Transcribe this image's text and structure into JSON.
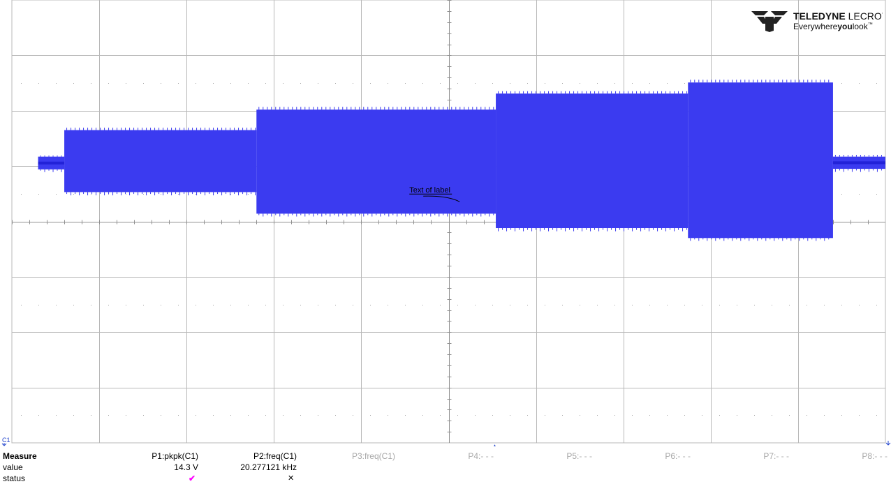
{
  "chart_data": {
    "type": "line",
    "title": "",
    "xlabel": "",
    "ylabel": "",
    "grid": true,
    "grid_divisions": {
      "x": 10,
      "y": 8
    },
    "xlim": [
      0,
      10
    ],
    "ylim": [
      -4,
      4
    ],
    "x_unit": "div",
    "y_unit": "div",
    "trace_color": "#3b3bf0",
    "series": [
      {
        "segments": [
          {
            "x_start": 0.3,
            "x_end": 0.6,
            "y_min": 0.94,
            "y_max": 1.17
          },
          {
            "x_start": 0.6,
            "x_end": 2.8,
            "y_min": 0.53,
            "y_max": 1.65
          },
          {
            "x_start": 2.8,
            "x_end": 5.54,
            "y_min": 0.14,
            "y_max": 2.02
          },
          {
            "x_start": 5.54,
            "x_end": 7.74,
            "y_min": -0.12,
            "y_max": 2.31
          },
          {
            "x_start": 7.74,
            "x_end": 9.4,
            "y_min": -0.3,
            "y_max": 2.51
          },
          {
            "x_start": 9.4,
            "x_end": 10.0,
            "y_min": 0.95,
            "y_max": 1.17
          }
        ]
      }
    ],
    "annotations": [
      {
        "text": "Text of label",
        "x": 4.55,
        "y": 0.52
      }
    ],
    "channel_marker": "C1",
    "trigger_marker": "▲"
  },
  "logo": {
    "brand_bold": "TELEDYNE",
    "brand_light": " LECROY",
    "tagline_pre": "Everywhere",
    "tagline_bold": "you",
    "tagline_post": "look",
    "tagline_tm": "™"
  },
  "measure": {
    "row_labels": {
      "header": "Measure",
      "value": "value",
      "status": "status"
    },
    "params": [
      {
        "header": "P1:pkpk(C1)",
        "value": "14.3 V",
        "status": "✔",
        "active": true
      },
      {
        "header": "P2:freq(C1)",
        "value": "20.277121 kHz",
        "status": "✕",
        "active": true
      },
      {
        "header": "P3:freq(C1)",
        "value": "",
        "status": "",
        "active": false
      },
      {
        "header": "P4:- - -",
        "value": "",
        "status": "",
        "active": false
      },
      {
        "header": "P5:- - -",
        "value": "",
        "status": "",
        "active": false
      },
      {
        "header": "P6:- - -",
        "value": "",
        "status": "",
        "active": false
      },
      {
        "header": "P7:- - -",
        "value": "",
        "status": "",
        "active": false
      },
      {
        "header": "P8:- - -",
        "value": "",
        "status": "",
        "active": false
      }
    ]
  },
  "colors": {
    "grid_major": "#b8b8b8",
    "grid_dots": "#a0a0a0",
    "trace": "#3b3bf0",
    "trace_dark": "#2222d8",
    "marker": "#2244cc",
    "check": "#ff00ff"
  }
}
